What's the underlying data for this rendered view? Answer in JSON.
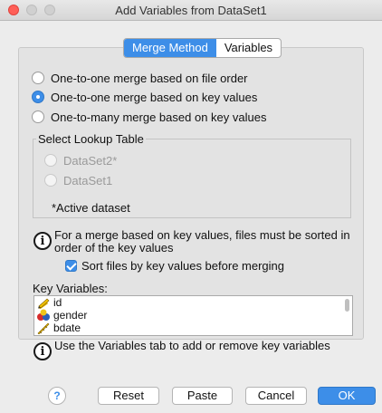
{
  "window": {
    "title": "Add Variables from DataSet1"
  },
  "tabs": [
    {
      "label": "Merge Method",
      "active": true
    },
    {
      "label": "Variables",
      "active": false
    }
  ],
  "merge_options": [
    {
      "label": "One-to-one merge based on file order",
      "selected": false
    },
    {
      "label": "One-to-one merge based on key values",
      "selected": true
    },
    {
      "label": "One-to-many merge based on key values",
      "selected": false
    }
  ],
  "lookup": {
    "legend": "Select Lookup Table",
    "items": [
      {
        "label": "DataSet2*",
        "enabled": false
      },
      {
        "label": "DataSet1",
        "enabled": false
      }
    ],
    "note": "*Active dataset"
  },
  "info1": {
    "line1": "For a merge based on key values, files must be sorted in",
    "line2": "order of the key values"
  },
  "sort_checkbox": {
    "label": "Sort files by key values before merging",
    "checked": true
  },
  "key_variables": {
    "label": "Key Variables:",
    "items": [
      {
        "name": "id",
        "icon": "pencil-ruler-icon"
      },
      {
        "name": "gender",
        "icon": "nominal-variable-icon"
      },
      {
        "name": "bdate",
        "icon": "scale-variable-icon"
      }
    ]
  },
  "info2": {
    "text": "Use the Variables tab to add or remove key variables"
  },
  "buttons": {
    "help": "?",
    "reset": "Reset",
    "paste": "Paste",
    "cancel": "Cancel",
    "ok": "OK"
  },
  "colors": {
    "accent": "#3d8ee8",
    "close": "#ff5f57"
  }
}
